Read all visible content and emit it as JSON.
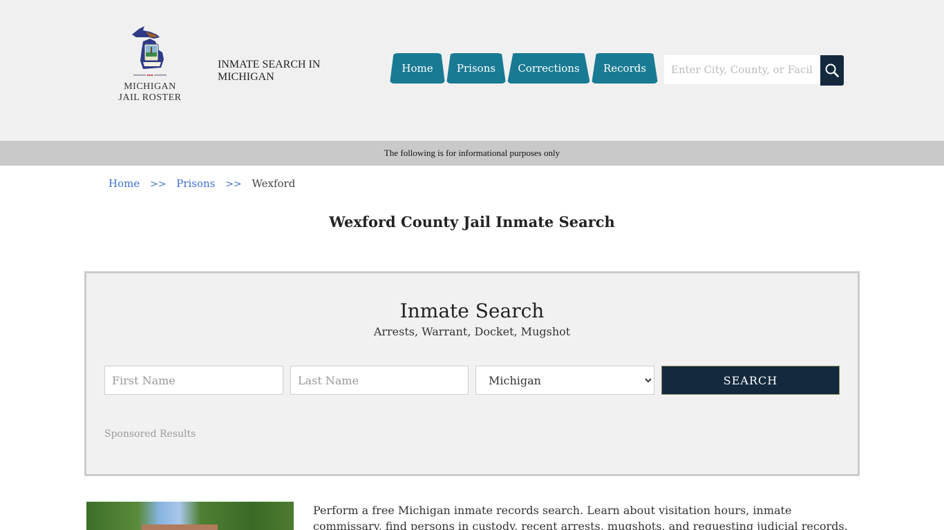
{
  "header": {
    "logo_line1": "MICHIGAN",
    "logo_line2": "JAIL ROSTER",
    "tagline": "INMATE SEARCH IN MICHIGAN",
    "nav": [
      {
        "label": "Home"
      },
      {
        "label": "Prisons"
      },
      {
        "label": "Corrections"
      },
      {
        "label": "Records"
      }
    ],
    "search_placeholder": "Enter City, County, or Facility",
    "search_icon": "magnifier-icon",
    "colors": {
      "nav_bg": "#197a93",
      "search_btn_bg": "#13293d",
      "header_bg": "#f0f0f0"
    }
  },
  "notice": "The following is for informational purposes only",
  "breadcrumb": {
    "items": [
      {
        "label": "Home"
      },
      {
        "label": "Prisons"
      }
    ],
    "separator": ">>",
    "current": "Wexford"
  },
  "page_title": "Wexford County Jail Inmate Search",
  "search_panel": {
    "title": "Inmate Search",
    "subtitle": "Arrests, Warrant, Docket, Mugshot",
    "first_name_placeholder": "First Name",
    "last_name_placeholder": "Last Name",
    "state_selected": "Michigan",
    "submit_label": "SEARCH",
    "sponsored_label": "Sponsored Results"
  },
  "intro": {
    "text": "Perform a free Michigan inmate records search. Learn about visitation hours, inmate commissary, find persons in custody, recent arrests, mugshots, and requesting judicial records."
  }
}
